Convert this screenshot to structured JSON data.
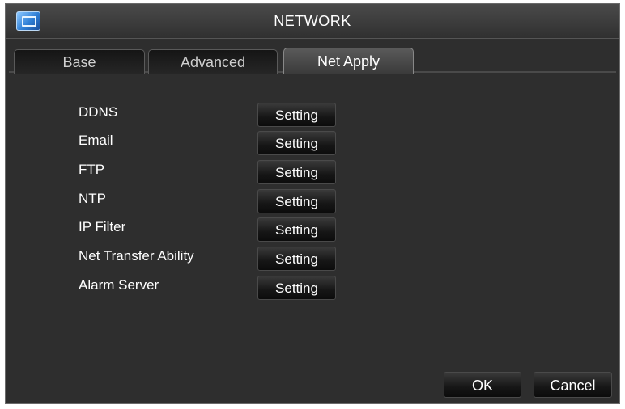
{
  "window": {
    "title": "NETWORK"
  },
  "tabs": [
    {
      "label": "Base",
      "active": false
    },
    {
      "label": "Advanced",
      "active": false
    },
    {
      "label": "Net Apply",
      "active": true
    }
  ],
  "rows": [
    {
      "label": "DDNS",
      "button": "Setting"
    },
    {
      "label": "Email",
      "button": "Setting"
    },
    {
      "label": "FTP",
      "button": "Setting"
    },
    {
      "label": "NTP",
      "button": "Setting"
    },
    {
      "label": "IP Filter",
      "button": "Setting"
    },
    {
      "label": "Net Transfer Ability",
      "button": "Setting"
    },
    {
      "label": "Alarm Server",
      "button": "Setting"
    }
  ],
  "footer": {
    "ok_label": "OK",
    "cancel_label": "Cancel"
  },
  "colors": {
    "panel": "#2e2e2e",
    "text": "#ffffff",
    "border": "#6a6a6a"
  }
}
